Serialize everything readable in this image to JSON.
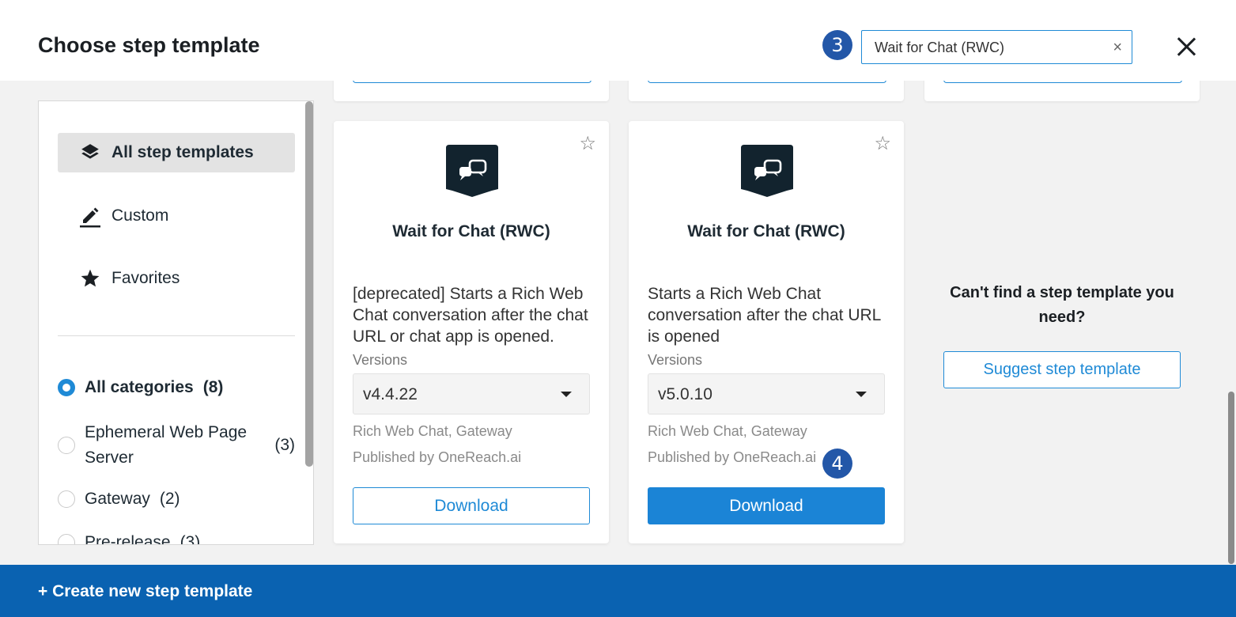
{
  "header": {
    "title": "Choose step template",
    "search_badge": "3",
    "search_value": "Wait for Chat (RWC)",
    "clear_glyph": "×"
  },
  "sidebar": {
    "nav": [
      {
        "label": "All step templates",
        "icon": "layers-icon",
        "active": true
      },
      {
        "label": "Custom",
        "icon": "pencil-icon",
        "active": false
      },
      {
        "label": "Favorites",
        "icon": "star-icon",
        "active": false
      }
    ],
    "categories": [
      {
        "label": "All categories",
        "count": "(8)",
        "selected": true
      },
      {
        "label": "Ephemeral Web Page Server",
        "count": "(3)",
        "selected": false
      },
      {
        "label": "Gateway",
        "count": "(2)",
        "selected": false
      },
      {
        "label": "Pre-release",
        "count": "(3)",
        "selected": false
      }
    ]
  },
  "cards": [
    {
      "name": "Wait for Chat (RWC)",
      "description": "[deprecated] Starts a Rich Web Chat conversation after the chat URL or chat app is opened.",
      "versions_label": "Versions",
      "version": "v4.4.22",
      "tags": "Rich Web Chat, Gateway",
      "publisher": "Published by OneReach.ai",
      "download_label": "Download"
    },
    {
      "name": "Wait for Chat (RWC)",
      "description": "Starts a Rich Web Chat conversation after the chat URL is opened",
      "versions_label": "Versions",
      "version": "v5.0.10",
      "tags": "Rich Web Chat, Gateway",
      "publisher": "Published by OneReach.ai",
      "download_label": "Download",
      "badge": "4"
    }
  ],
  "suggest": {
    "question": "Can't find a step template you need?",
    "button_label": "Suggest step template"
  },
  "footer": {
    "create_label": "+ Create new step template"
  },
  "colors": {
    "accent": "#1f8ad6",
    "footer": "#0a62b1",
    "badge": "#2357a8",
    "logo": "#12232e"
  }
}
